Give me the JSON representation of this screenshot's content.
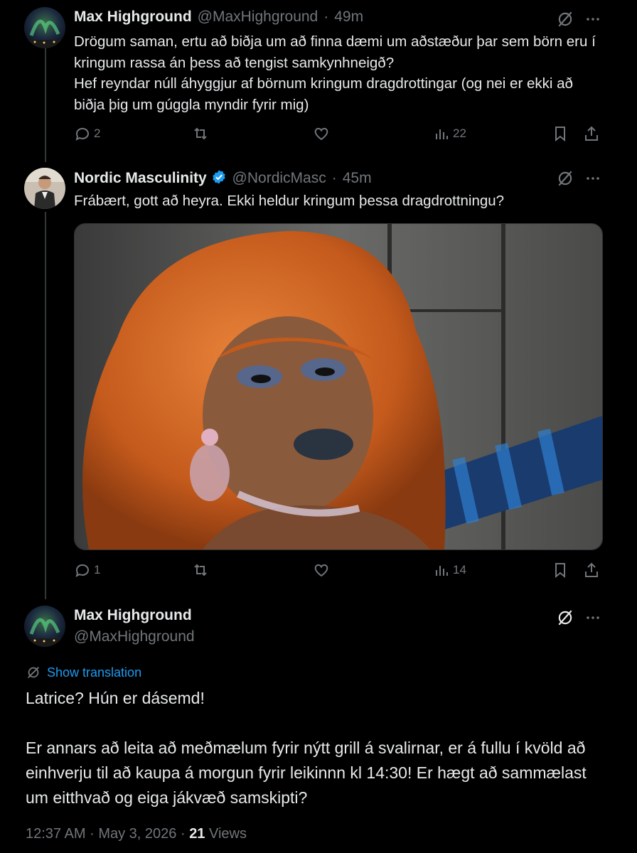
{
  "tweet1": {
    "name": "Max Highground",
    "handle": "@MaxHighground",
    "sep": "·",
    "time": "49m",
    "text": "Drögum saman, ertu að biðja um að finna dæmi um aðstæður þar sem börn eru í kringum rassa án þess að tengist samkynhneigð?\nHef reyndar núll áhyggjur af börnum kringum dragdrottingar (og nei er ekki að biðja þig um gúggla myndir fyrir mig)",
    "replies": "2",
    "views": "22"
  },
  "tweet2": {
    "name": "Nordic Masculinity",
    "handle": "@NordicMasc",
    "sep": "·",
    "time": "45m",
    "text": "Frábært, gott að heyra. Ekki heldur kringum þessa dragdrottningu?",
    "replies": "1",
    "views": "14",
    "image_desc": "drag queen photo"
  },
  "main": {
    "name": "Max Highground",
    "handle": "@MaxHighground",
    "translate": "Show translation",
    "text": "Latrice? Hún er dásemd!\n\nEr annars að leita að meðmælum fyrir nýtt grill á svalirnar, er á fullu í kvöld að einhverju til að kaupa á morgun fyrir leikinnn kl 14:30! Er hægt að sammælast um eitthvað og eiga jákvæð samskipti?",
    "time": "12:37 AM",
    "date": "May 3, 2026",
    "sep": "·",
    "views_count": "21",
    "views_label": "Views"
  },
  "colors": {
    "accent": "#1d9bf0",
    "muted": "#71767b",
    "text": "#e7e9ea",
    "background": "#000000"
  },
  "icons": [
    "reply-icon",
    "retweet-icon",
    "like-icon",
    "views-icon",
    "bookmark-icon",
    "share-icon",
    "grok-icon",
    "more-icon",
    "verified-icon",
    "translate-icon"
  ]
}
